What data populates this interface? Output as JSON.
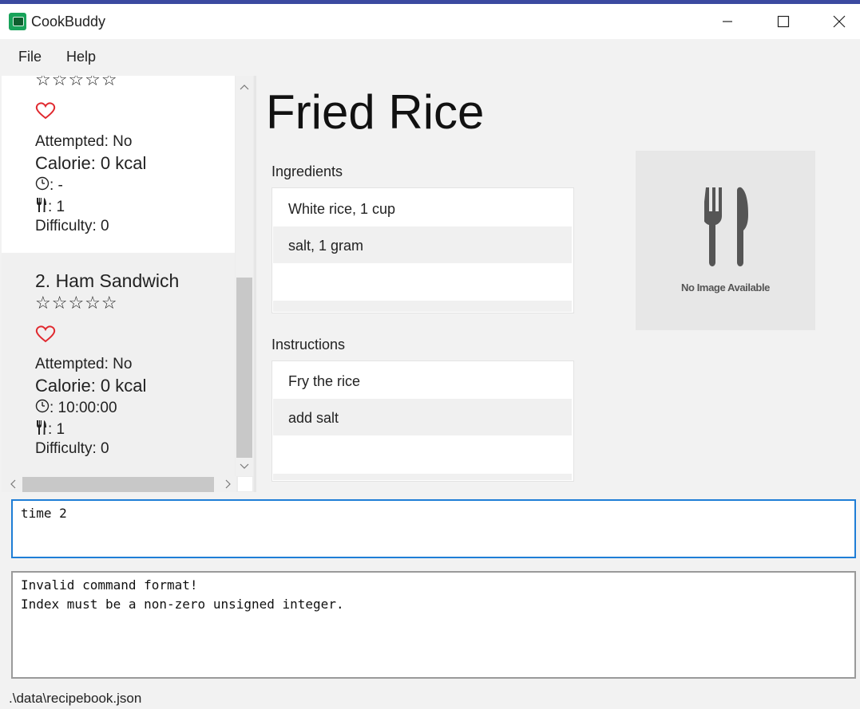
{
  "window": {
    "title": "CookBuddy",
    "controls": [
      "minimize",
      "maximize",
      "close"
    ]
  },
  "menu": {
    "items": [
      "File",
      "Help"
    ]
  },
  "recipe_list": {
    "items": [
      {
        "index_name": "",
        "stars": "☆☆☆☆☆",
        "favourite_icon": "heart-outline-icon",
        "attempted": "Attempted: No",
        "calorie": "Calorie: 0 kcal",
        "time": ": -",
        "serving": ": 1",
        "difficulty": "Difficulty: 0"
      },
      {
        "index_name": "2.  Ham Sandwich",
        "stars": "☆☆☆☆☆",
        "favourite_icon": "heart-outline-icon",
        "attempted": "Attempted: No",
        "calorie": "Calorie: 0 kcal",
        "time": ": 10:00:00",
        "serving": ": 1",
        "difficulty": "Difficulty: 0"
      }
    ]
  },
  "detail": {
    "title": "Fried Rice",
    "ingredients_label": "Ingredients",
    "ingredients": [
      "White rice, 1 cup",
      "salt, 1 gram"
    ],
    "instructions_label": "Instructions",
    "instructions": [
      "Fry the rice",
      "add salt"
    ],
    "image_caption": "No Image Available"
  },
  "command": {
    "value": "time 2"
  },
  "result": {
    "lines": [
      "Invalid command format!",
      "Index must be a non-zero unsigned integer."
    ]
  },
  "status_bar": {
    "path": ".\\data\\recipebook.json"
  },
  "colors": {
    "accent": "#1f7ed6",
    "heart": "#e0282e",
    "app_icon": "#18a35a"
  }
}
